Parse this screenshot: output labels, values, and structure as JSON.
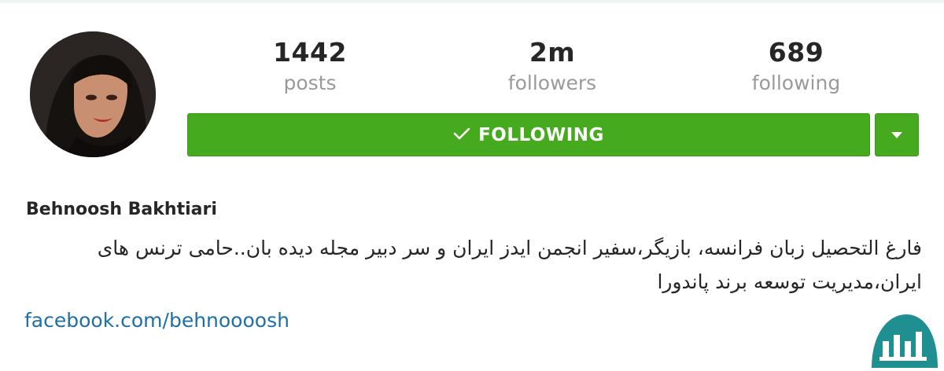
{
  "profile": {
    "username": "Behnoosh Bakhtiari",
    "bio": "فارغ التحصیل زبان فرانسه، بازیگر،سفیر انجمن ایدز ایران و سر دبیر مجله دیده بان..حامی ترنس های ایران،مدیریت توسعه برند پاندورا",
    "website": "facebook.com/behnoooosh"
  },
  "stats": {
    "posts": {
      "value": "1442",
      "label": "posts"
    },
    "followers": {
      "value": "2m",
      "label": "followers"
    },
    "following": {
      "value": "689",
      "label": "following"
    }
  },
  "actions": {
    "follow_label": "FOLLOWING",
    "follow_icon": "checkmark-icon",
    "dropdown_icon": "caret-down-icon"
  },
  "colors": {
    "button_green": "#45aa1e",
    "link_blue": "#1e6fa8",
    "label_gray": "#9a9a9a",
    "watermark_teal": "#1f8f92"
  }
}
